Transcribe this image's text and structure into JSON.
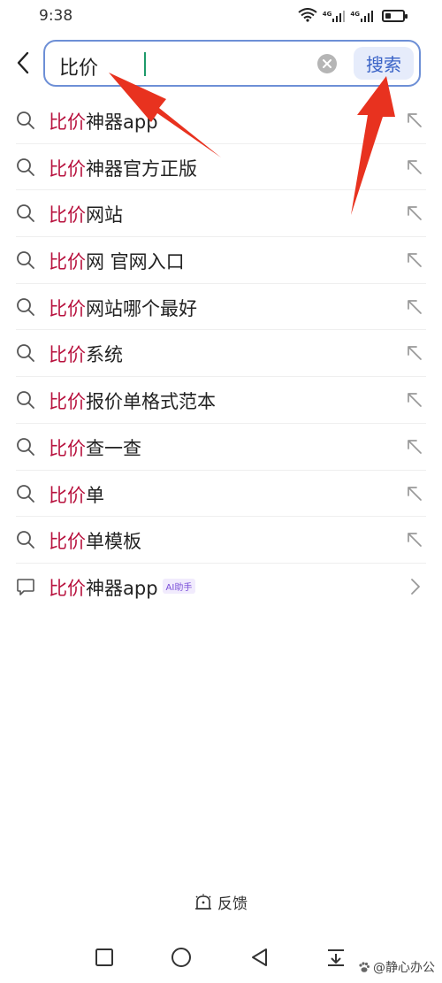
{
  "status_bar": {
    "time": "9:38",
    "network1": "4G",
    "network2": "4G",
    "battery_level": 0.35
  },
  "search": {
    "query": "比价",
    "search_button": "搜索"
  },
  "suggestions": [
    {
      "highlight": "比价",
      "rest": "神器app",
      "icon": "search-icon",
      "action": "fill-arrow-icon"
    },
    {
      "highlight": "比价",
      "rest": "神器官方正版",
      "icon": "search-icon",
      "action": "fill-arrow-icon"
    },
    {
      "highlight": "比价",
      "rest": "网站",
      "icon": "search-icon",
      "action": "fill-arrow-icon"
    },
    {
      "highlight": "比价",
      "rest": "网 官网入口",
      "icon": "search-icon",
      "action": "fill-arrow-icon"
    },
    {
      "highlight": "比价",
      "rest": "网站哪个最好",
      "icon": "search-icon",
      "action": "fill-arrow-icon"
    },
    {
      "highlight": "比价",
      "rest": "系统",
      "icon": "search-icon",
      "action": "fill-arrow-icon"
    },
    {
      "highlight": "比价",
      "rest": "报价单格式范本",
      "icon": "search-icon",
      "action": "fill-arrow-icon"
    },
    {
      "highlight": "比价",
      "rest": "查一查",
      "icon": "search-icon",
      "action": "fill-arrow-icon"
    },
    {
      "highlight": "比价",
      "rest": "单",
      "icon": "search-icon",
      "action": "fill-arrow-icon"
    },
    {
      "highlight": "比价",
      "rest": "单模板",
      "icon": "search-icon",
      "action": "fill-arrow-icon"
    },
    {
      "highlight": "比价",
      "rest": "神器app",
      "icon": "chat-bubble-icon",
      "action": "chevron-right-icon",
      "badge": "AI助手"
    }
  ],
  "feedback": {
    "label": "反馈",
    "icon": "feedback-icon"
  },
  "nav_bar": {
    "icons": [
      "square-icon",
      "circle-icon",
      "triangle-back-icon",
      "download-tray-icon"
    ]
  },
  "watermark": {
    "text": "@静心办公"
  },
  "colors": {
    "highlight": "#b8123e",
    "accent": "#3a63c7",
    "search_border": "#6d8fd6",
    "annotation": "#e8321f"
  }
}
